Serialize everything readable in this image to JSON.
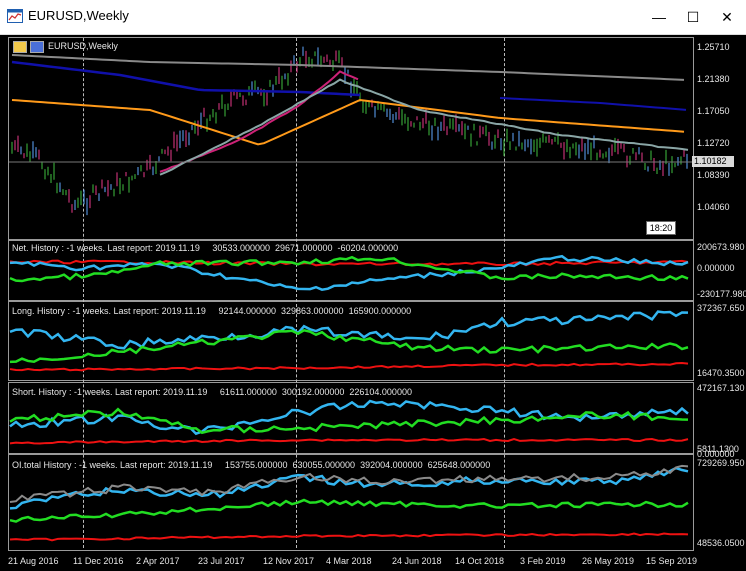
{
  "window": {
    "title": "EURUSD,Weekly",
    "minimize": "—",
    "maximize": "☐",
    "close": "✕"
  },
  "main_chart": {
    "symbol_label": "EURUSD,Weekly",
    "price_labels": [
      "1.25710",
      "1.21380",
      "1.17050",
      "1.12720",
      "1.08390",
      "1.04060"
    ],
    "current_price": "1.10182",
    "time_left": "18:20"
  },
  "panes": [
    {
      "label": "Net. History : -1 weeks. Last report: 2019.11.19     30533.000000  29671.000000  -60204.000000",
      "axis_top": "200673.980",
      "axis_mid": "0.000000",
      "axis_bottom": "-230177.980"
    },
    {
      "label": "Long. History : -1 weeks. Last report: 2019.11.19     92144.000000  329863.000000  165900.000000",
      "axis_top": "372367.650",
      "axis_bottom": "16470.3500"
    },
    {
      "label": "Short. History : -1 weeks. Last report: 2019.11.19     61611.000000  300192.000000  226104.000000",
      "axis_top": "472167.130",
      "axis_bottom": "5811.1300"
    },
    {
      "label": "OI.total History : -1 weeks. Last report: 2019.11.19     153755.000000  630055.000000  392004.000000  625648.000000",
      "axis_top": "729269.950",
      "axis_mid": "0.000000",
      "axis_bottom": "48536.0500"
    }
  ],
  "dates": [
    "21 Aug 2016",
    "11 Dec 2016",
    "2 Apr 2017",
    "23 Jul 2017",
    "12 Nov 2017",
    "4 Mar 2018",
    "24 Jun 2018",
    "14 Oct 2018",
    "3 Feb 2019",
    "26 May 2019",
    "15 Sep 2019"
  ],
  "colors": {
    "background": "#000000",
    "grid": "#9a9a9a",
    "cyan": "#33b5f0",
    "green": "#22dd22",
    "red": "#ee1111",
    "gray": "#8a8a8a",
    "orange": "#ff9a1a",
    "navy": "#1010aa",
    "magenta": "#cc2277"
  },
  "icons": {
    "app": "chart-window-icon",
    "chart": "chart-list-icon"
  }
}
